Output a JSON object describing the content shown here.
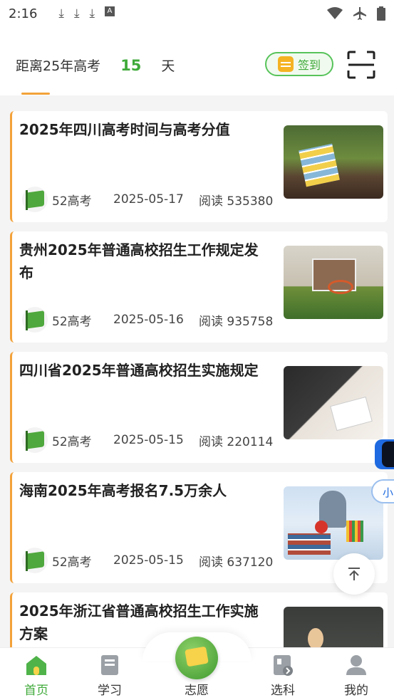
{
  "status_bar": {
    "time": "2:16",
    "icons": [
      "download-icon",
      "download-icon",
      "download-icon",
      "font-icon"
    ],
    "right_icons": [
      "wifi-icon",
      "airplane-icon",
      "battery-icon"
    ]
  },
  "header": {
    "countdown_prefix": "距离25年高考",
    "countdown_days": "15",
    "countdown_suffix": "天",
    "checkin_label": "签到"
  },
  "articles": [
    {
      "title": "2025年四川高考时间与高考分值",
      "source": "52高考",
      "date": "2025-05-17",
      "reads": "阅读 535380"
    },
    {
      "title": "贵州2025年普通高校招生工作规定发布",
      "source": "52高考",
      "date": "2025-05-16",
      "reads": "阅读 935758"
    },
    {
      "title": "四川省2025年普通高校招生实施规定",
      "source": "52高考",
      "date": "2025-05-15",
      "reads": "阅读 220114"
    },
    {
      "title": "海南2025年高考报名7.5万余人",
      "source": "52高考",
      "date": "2025-05-15",
      "reads": "阅读 637120"
    },
    {
      "title": "2025年浙江省普通高校招生工作实施方案",
      "source": "",
      "date": "",
      "reads": ""
    }
  ],
  "side_pill": "小",
  "tabbar": {
    "tabs": [
      {
        "label": "首页",
        "icon": "home-icon",
        "active": true
      },
      {
        "label": "学习",
        "icon": "book-icon",
        "active": false
      },
      {
        "label": "志愿",
        "icon": "volunteer-icon",
        "active": false
      },
      {
        "label": "选科",
        "icon": "subject-icon",
        "active": false
      },
      {
        "label": "我的",
        "icon": "profile-icon",
        "active": false
      }
    ]
  },
  "colors": {
    "accent_green": "#3faa3a",
    "accent_orange": "#f3a23a"
  }
}
